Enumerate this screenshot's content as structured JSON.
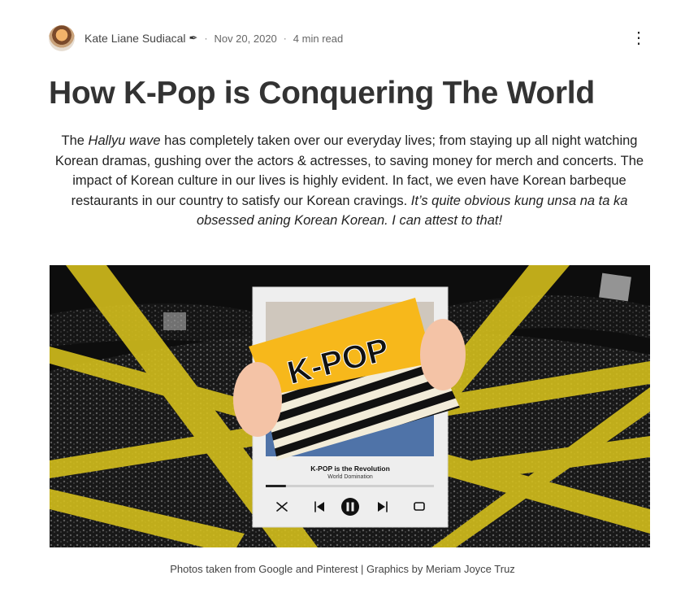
{
  "author": {
    "name": "Kate Liane Sudiacal",
    "badge_icon": "quill-icon",
    "date": "Nov 20, 2020",
    "read_time": "4 min read",
    "separator": "·"
  },
  "more_icon": "more-vertical-icon",
  "title": "How K-Pop is Conquering The World",
  "intro": {
    "p1": "The ",
    "p1_em": "Hallyu wave",
    "p2": " has completely taken over our everyday lives; from staying up all night watching Korean dramas, gushing over the actors & actresses, to saving money for merch and concerts. The impact of Korean culture in our lives is highly evident. In fact, we even have Korean barbeque restaurants in our country to satisfy our Korean cravings. ",
    "p2_em": "It’s quite obvious kung unsa na ta ka obsessed aning Korean Korean. I can attest to that!"
  },
  "hero": {
    "card_banner": "K-POP",
    "track_title": "K-POP is the Revolution",
    "track_subtitle": "World Domination",
    "progress": 0.12,
    "controls": [
      "shuffle-icon",
      "previous-icon",
      "pause-icon",
      "next-icon",
      "repeat-icon"
    ],
    "colors": {
      "tape": "#d8c21c",
      "banner": "#f7b81b",
      "card": "#eeeeee"
    }
  },
  "caption": "Photos taken from Google and Pinterest | Graphics by Meriam Joyce Truz"
}
